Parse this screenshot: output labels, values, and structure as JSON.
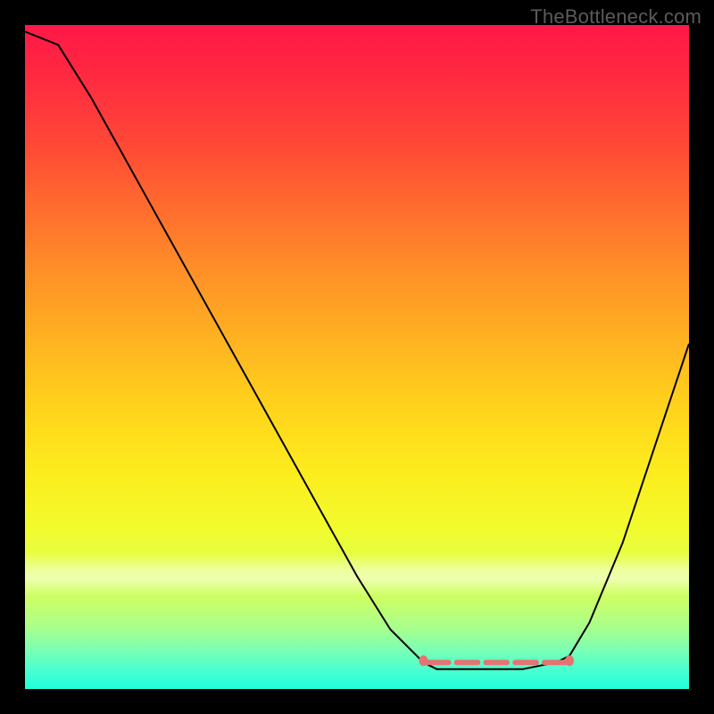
{
  "watermark": "TheBottleneck.com",
  "chart_data": {
    "type": "line",
    "title": "",
    "xlabel": "",
    "ylabel": "",
    "xlim": [
      0,
      100
    ],
    "ylim": [
      0,
      100
    ],
    "grid": false,
    "legend": false,
    "series": [
      {
        "name": "curve",
        "x": [
          0,
          5,
          10,
          15,
          20,
          25,
          30,
          35,
          40,
          45,
          50,
          55,
          60,
          62,
          65,
          70,
          75,
          80,
          82,
          85,
          90,
          95,
          100
        ],
        "y": [
          99,
          97,
          89,
          80,
          71,
          62,
          53,
          44,
          35,
          26,
          17,
          9,
          4,
          3,
          3,
          3,
          3,
          4,
          5,
          10,
          22,
          37,
          52
        ]
      }
    ],
    "necklace": {
      "left_bead_x": 60,
      "right_bead_x": 82,
      "y": 4
    },
    "background_gradient_direction": "top-to-bottom",
    "background_note": "red→orange→yellow→green gradient with faint white band near bottom"
  },
  "colors": {
    "frame": "#000000",
    "curve_stroke": "#000000",
    "necklace": "#e57373",
    "watermark": "#5b5b5b"
  }
}
